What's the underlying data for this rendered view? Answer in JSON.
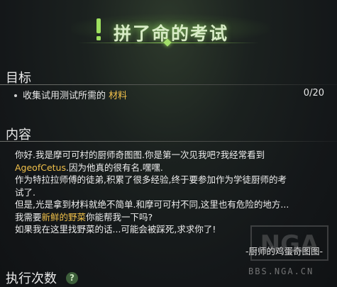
{
  "header": {
    "title": "拼了命的考试",
    "icon": "exclamation-icon",
    "accent_color": "#8fd05a"
  },
  "objective": {
    "heading": "目标",
    "text_prefix": "收集试用测试所需的 ",
    "item_link": "材料",
    "progress": "0/20",
    "progress_current": 0,
    "progress_total": 20,
    "link_color": "#f0c04a"
  },
  "content": {
    "heading": "内容",
    "lines": [
      {
        "pre": "你好.我是摩可可村的厨师奇图图.你是第一次见我吧?我经常看到",
        "hl": "",
        "post": ""
      },
      {
        "pre": "",
        "hl": "AgeofCetus",
        "post": ".因为他真的很有名.嘿嘿."
      },
      {
        "pre": "作为特拉拉师傅的徒弟,积累了很多经验,终于要参加作为学徒厨师的考",
        "hl": "",
        "post": ""
      },
      {
        "pre": "试了.",
        "hl": "",
        "post": ""
      },
      {
        "pre": "但是,光是拿到材料就绝不简单.和摩可可村不同,这里也有危险的地方...",
        "hl": "",
        "post": ""
      },
      {
        "pre": "我需要",
        "hl": "新鲜的野菜",
        "post": "你能帮我一下吗?"
      },
      {
        "pre": "如果我在这里找野菜的话...可能会被踩死,求求你了!",
        "hl": "",
        "post": ""
      }
    ],
    "signature": "-厨师的鸡蛋奇图图-"
  },
  "footer": {
    "exec_label": "执行次数",
    "help_symbol": "?"
  },
  "watermark": {
    "logo": "NGA",
    "url": "BBS.NGA.CN"
  }
}
